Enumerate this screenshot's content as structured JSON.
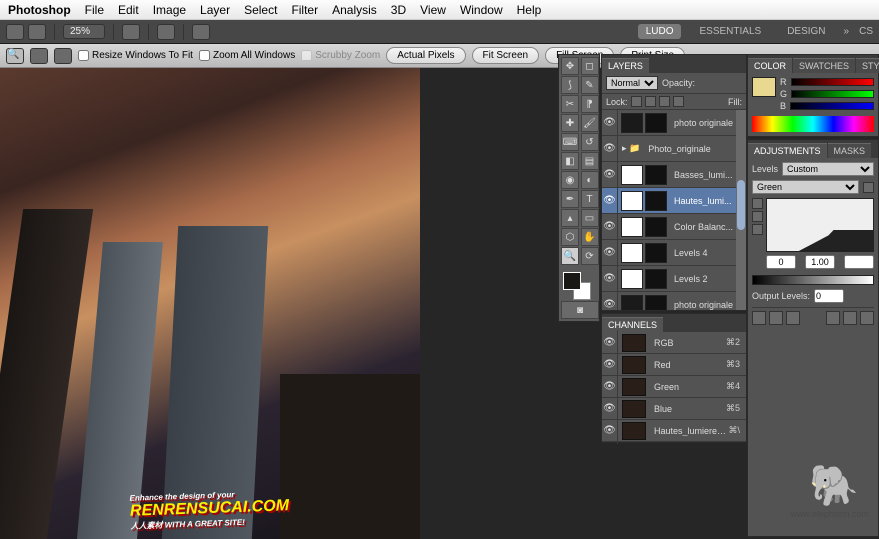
{
  "menubar": {
    "app": "Photoshop",
    "items": [
      "File",
      "Edit",
      "Image",
      "Layer",
      "Select",
      "Filter",
      "Analysis",
      "3D",
      "View",
      "Window",
      "Help"
    ]
  },
  "topbar": {
    "zoom": "25%",
    "workspaces": [
      "LUDO",
      "ESSENTIALS",
      "DESIGN"
    ],
    "ws_active": "LUDO",
    "cs": "CS"
  },
  "optbar": {
    "resize_label": "Resize Windows To Fit",
    "zoom_all_label": "Zoom All Windows",
    "scrubby_label": "Scrubby Zoom",
    "btns": [
      "Actual Pixels",
      "Fit Screen",
      "Fill Screen",
      "Print Size"
    ]
  },
  "layers_panel": {
    "tab": "LAYERS",
    "blend": "Normal",
    "opacity_label": "Opacity:",
    "lock_label": "Lock:",
    "fill_label": "Fill:",
    "layers": [
      {
        "name": "photo originale cop",
        "type": "image",
        "selected": false,
        "group": false
      },
      {
        "name": "Photo_originale",
        "type": "group",
        "selected": false,
        "group": true
      },
      {
        "name": "Basses_lumi...",
        "type": "adj",
        "selected": false,
        "group": false
      },
      {
        "name": "Hautes_lumi...",
        "type": "adj",
        "selected": true,
        "group": false
      },
      {
        "name": "Color Balanc...",
        "type": "adj",
        "selected": false,
        "group": false
      },
      {
        "name": "Levels 4",
        "type": "adj",
        "selected": false,
        "group": false
      },
      {
        "name": "Levels 2",
        "type": "adj",
        "selected": false,
        "group": false
      },
      {
        "name": "photo originale",
        "type": "image",
        "selected": false,
        "group": false
      }
    ]
  },
  "channels_panel": {
    "tab": "CHANNELS",
    "channels": [
      {
        "name": "RGB",
        "key": "⌘2"
      },
      {
        "name": "Red",
        "key": "⌘3"
      },
      {
        "name": "Green",
        "key": "⌘4"
      },
      {
        "name": "Blue",
        "key": "⌘5"
      },
      {
        "name": "Hautes_lumieres Mask",
        "key": "⌘\\"
      }
    ]
  },
  "color_panel": {
    "tabs": [
      "COLOR",
      "SWATCHES",
      "STYLES"
    ],
    "labels": [
      "R",
      "G",
      "B"
    ]
  },
  "adjustments_panel": {
    "tabs": [
      "ADJUSTMENTS",
      "MASKS"
    ],
    "type_label": "Levels",
    "preset": "Custom",
    "channel": "Green",
    "in_low": "0",
    "in_gamma": "1.00",
    "in_high": "",
    "out_label": "Output Levels:",
    "out_low": "0"
  },
  "watermark": {
    "top": "Enhance the design of your",
    "main": "RENRENSUCAI.COM",
    "sub": "人人素材 WITH A GREAT SITE!"
  },
  "elephorm": "www.elephorm.com"
}
